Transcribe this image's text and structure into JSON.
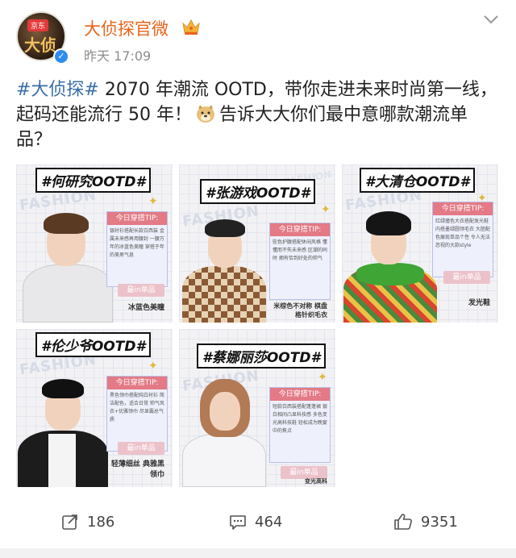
{
  "post": {
    "user_name": "大侦探官微",
    "time": "昨天 17:09",
    "hashtag": "#大侦探#",
    "text_before_emoji": " 2070 年潮流 OOTD，带你走进未来时尚第一线，起码还能流行 50 年！",
    "text_after_emoji": "告诉大大你们最中意哪款潮流单品？",
    "avatar_brand": "京东",
    "avatar_art": "大侦探"
  },
  "tiles": [
    {
      "title": "#何研究OOTD#",
      "tip_head": "今日穿搭TIP:",
      "tip_text": "银衬衫搭配长款白西装 金属未来感再用腰封 一腰万年的冰蓝色美瞳 穿搭于年的美男气息",
      "pick_label": "最in单品",
      "pick_item": "冰蓝色美瞳"
    },
    {
      "title": "#张游戏OOTD#",
      "tip_head": "今日穿搭TIP:",
      "tip_text": "驼色护腰搭配休闲风格 懂懂而不失未来感 区潮的同时 拥有恰到好处的帅气",
      "pick_label": "",
      "pick_item": "米棕色不对称 棋盘格针织毛衣"
    },
    {
      "title": "#大清仓OOTD#",
      "tip_head": "今日穿搭TIP:",
      "tip_text": "红绿撞色大衣搭配发光鞋 内搭墨绿圆领毛衣 大胆配色展现单品个性 令人无法忽视的大款style",
      "pick_label": "最in单品",
      "pick_item": "发光鞋"
    },
    {
      "title": "#伦少爷OOTD#",
      "tip_head": "今日穿搭TIP:",
      "tip_text": "黑色领巾搭配纯白衬衫 简洁配色，适合日常 帅气风衣+优雅领巾 尽显霸总气质",
      "pick_label": "最in单品",
      "pick_item": "轻薄细丝 典雅黑领巾"
    },
    {
      "title": "#蔡娜丽莎OOTD#",
      "tip_head": "今日穿搭TIP:",
      "tip_text": "短款白西装搭配蓬蓬裙 银白相间凸显科技感 多色变光高科技鞋 轻松成为晚宴中的焦点",
      "pick_label": "最in单品",
      "pick_item": "变光高科"
    }
  ],
  "actions": {
    "repost_count": "186",
    "comment_count": "464",
    "like_count": "9351"
  },
  "icons": {
    "crown": "crown-icon",
    "verified": "verified-icon",
    "chevron": "chevron-down-icon",
    "doge": "doge-emoji-icon",
    "repost": "repost-icon",
    "comment": "comment-icon",
    "like": "like-icon"
  },
  "watermark": "FASHION",
  "colors": {
    "user_name": "#e8641b",
    "hashtag": "#3a6ea5",
    "tip_head": "#e37a85"
  }
}
